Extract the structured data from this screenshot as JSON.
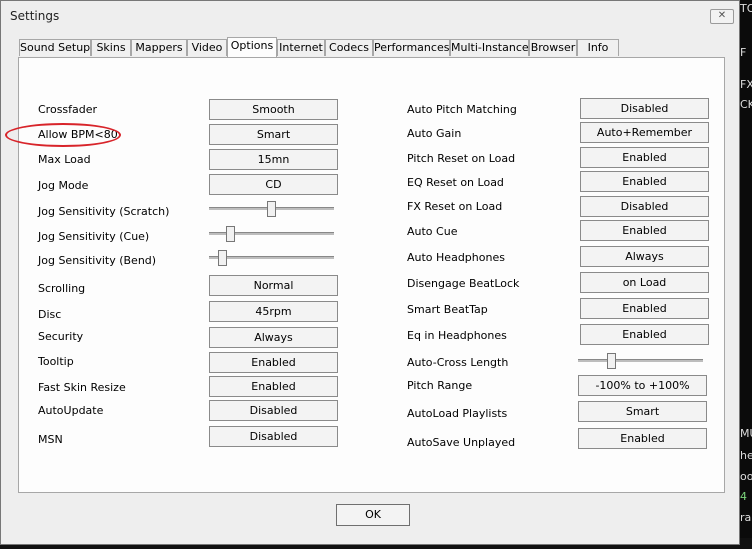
{
  "window": {
    "title": "Settings",
    "close_label": "✕"
  },
  "tabs": [
    {
      "label": "Sound Setup"
    },
    {
      "label": "Skins"
    },
    {
      "label": "Mappers"
    },
    {
      "label": "Video"
    },
    {
      "label": "Options",
      "active": true
    },
    {
      "label": "Internet"
    },
    {
      "label": "Codecs"
    },
    {
      "label": "Performances"
    },
    {
      "label": "Multi-Instance"
    },
    {
      "label": "Browser"
    },
    {
      "label": "Info"
    }
  ],
  "left": {
    "crossfader": {
      "label": "Crossfader",
      "value": "Smooth"
    },
    "allow_bpm": {
      "label": "Allow BPM<80",
      "value": "Smart"
    },
    "max_load": {
      "label": "Max Load",
      "value": "15mn"
    },
    "jog_mode": {
      "label": "Jog Mode",
      "value": "CD"
    },
    "jog_scratch": {
      "label": "Jog Sensitivity (Scratch)",
      "level": 0.5
    },
    "jog_cue": {
      "label": "Jog Sensitivity (Cue)",
      "level": 0.15
    },
    "jog_bend": {
      "label": "Jog Sensitivity (Bend)",
      "level": 0.08
    },
    "scrolling": {
      "label": "Scrolling",
      "value": "Normal"
    },
    "disc": {
      "label": "Disc",
      "value": "45rpm"
    },
    "security": {
      "label": "Security",
      "value": "Always"
    },
    "tooltip": {
      "label": "Tooltip",
      "value": "Enabled"
    },
    "fast_skin": {
      "label": "Fast Skin Resize",
      "value": "Enabled"
    },
    "autoupdate": {
      "label": "AutoUpdate",
      "value": "Disabled"
    },
    "msn": {
      "label": "MSN",
      "value": "Disabled"
    }
  },
  "right": {
    "auto_pitch": {
      "label": "Auto Pitch Matching",
      "value": "Disabled"
    },
    "auto_gain": {
      "label": "Auto Gain",
      "value": "Auto+Remember"
    },
    "pitch_reset": {
      "label": "Pitch Reset on Load",
      "value": "Enabled"
    },
    "eq_reset": {
      "label": "EQ Reset on Load",
      "value": "Enabled"
    },
    "fx_reset": {
      "label": "FX Reset on Load",
      "value": "Disabled"
    },
    "auto_cue": {
      "label": "Auto Cue",
      "value": "Enabled"
    },
    "auto_headphones": {
      "label": "Auto Headphones",
      "value": "Always"
    },
    "disengage": {
      "label": "Disengage BeatLock",
      "value": "on Load"
    },
    "smart_beattap": {
      "label": "Smart BeatTap",
      "value": "Enabled"
    },
    "eq_headphones": {
      "label": "Eq in Headphones",
      "value": "Enabled"
    },
    "autocross": {
      "label": "Auto-Cross Length",
      "level": 0.25
    },
    "pitch_range": {
      "label": "Pitch Range",
      "value": "-100% to +100%"
    },
    "autoload": {
      "label": "AutoLoad Playlists",
      "value": "Smart"
    },
    "autosave": {
      "label": "AutoSave Unplayed",
      "value": "Enabled"
    }
  },
  "ok_label": "OK",
  "background_fragments": {
    "frag1": "TO",
    "frag2": "F",
    "frag3": "FX",
    "frag4": "CK",
    "frag5": "MU",
    "frag6": "he",
    "frag7": "oo",
    "frag8": "4",
    "frag9": "ra"
  },
  "colors": {
    "annotation": "#d8242a",
    "window_bg": "#eeeeee",
    "panel_bg": "#fdfdfd"
  }
}
